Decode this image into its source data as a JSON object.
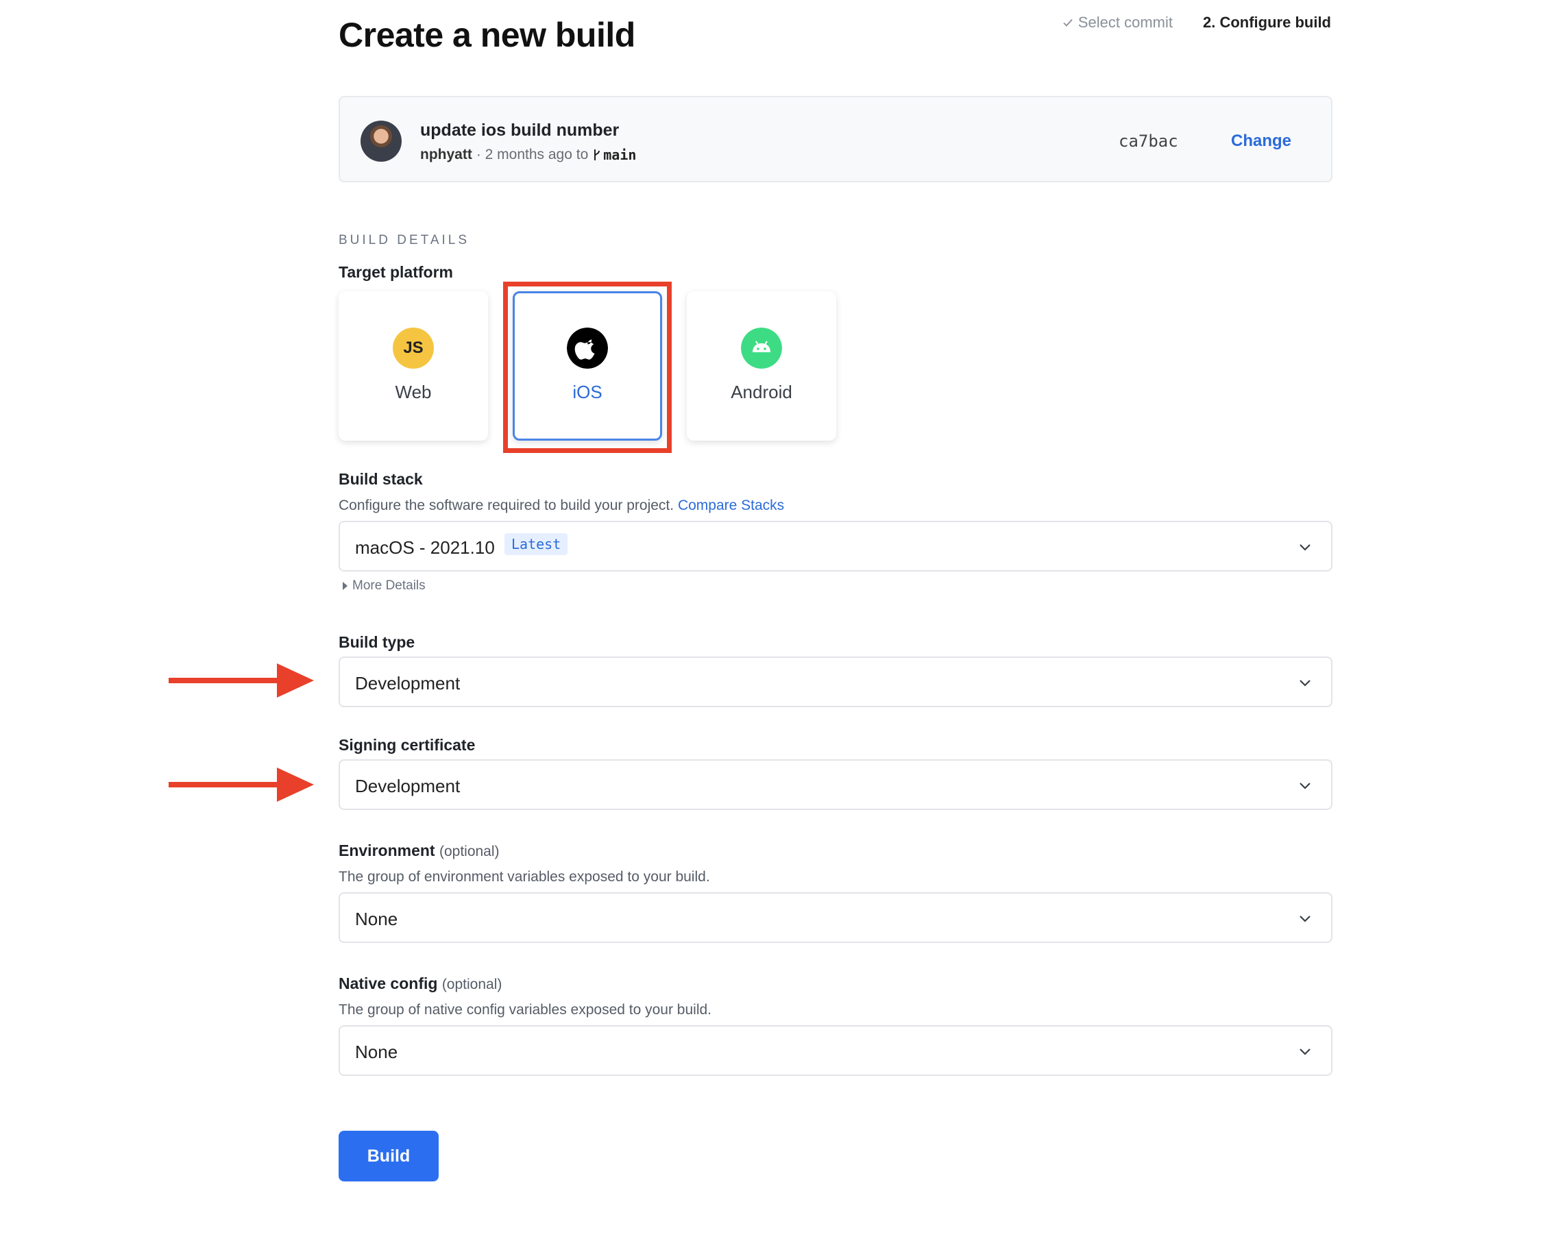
{
  "page": {
    "title": "Create a new build",
    "steps": [
      {
        "label": "Select commit"
      },
      {
        "label": "2. Configure build"
      }
    ]
  },
  "commit": {
    "message": "update ios build number",
    "author": "nphyatt",
    "time": "· 2 months ago to",
    "branch": "main",
    "sha": "ca7bac",
    "change_label": "Change"
  },
  "build_details": {
    "section_label": "BUILD DETAILS",
    "target_platform_label": "Target platform",
    "platforms": [
      {
        "label": "Web",
        "icon": "js-icon",
        "selected": false
      },
      {
        "label": "iOS",
        "icon": "apple-icon",
        "selected": true
      },
      {
        "label": "Android",
        "icon": "android-icon",
        "selected": false
      }
    ],
    "build_stack": {
      "label": "Build stack",
      "help": "Configure the software required to build your project.",
      "help_link": "Compare Stacks",
      "value": "macOS - 2021.10",
      "badge": "Latest",
      "more_details": "More Details"
    },
    "build_type": {
      "label": "Build type",
      "value": "Development"
    },
    "signing_certificate": {
      "label": "Signing certificate",
      "value": "Development"
    },
    "environment": {
      "label": "Environment",
      "optional": "(optional)",
      "help": "The group of environment variables exposed to your build.",
      "value": "None"
    },
    "native_config": {
      "label": "Native config",
      "optional": "(optional)",
      "help": "The group of native config variables exposed to your build.",
      "value": "None"
    }
  },
  "actions": {
    "build_label": "Build"
  },
  "colors": {
    "accent": "#2b6ff0",
    "link": "#2a6bd8",
    "annotation": "#e8402a",
    "js_badge": "#f5c542",
    "android": "#3ddc84"
  }
}
